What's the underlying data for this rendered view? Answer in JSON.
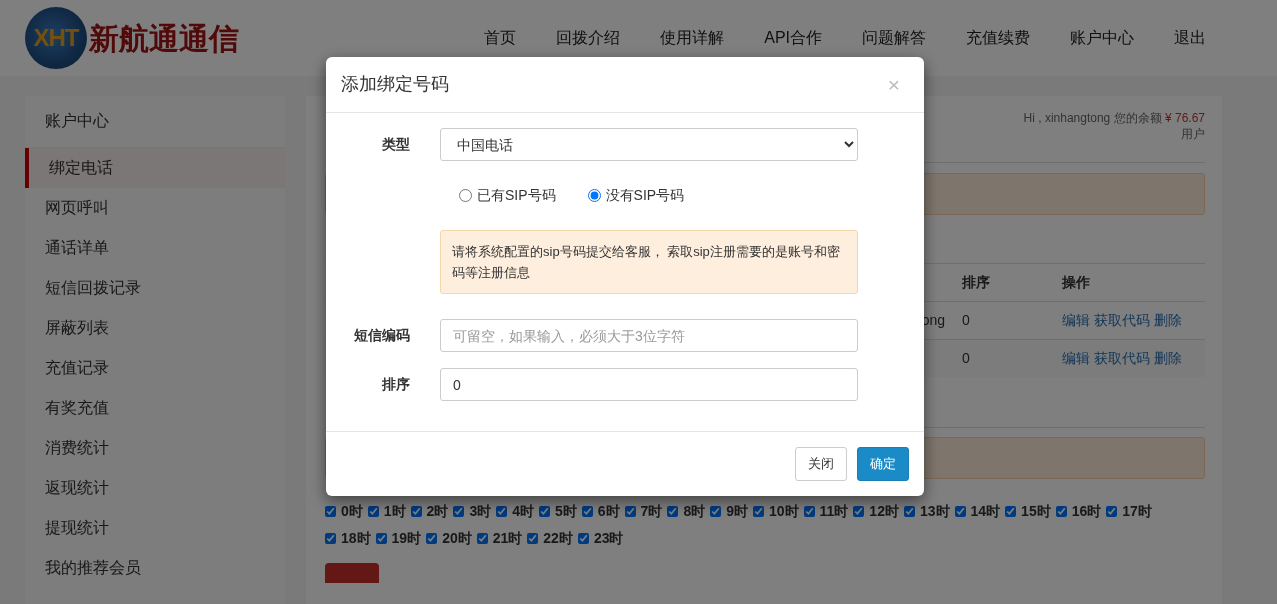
{
  "header": {
    "logo_mark": "XHT",
    "logo_text": "新航通通信",
    "nav": [
      {
        "label": "首页"
      },
      {
        "label": "回拨介绍"
      },
      {
        "label": "使用详解"
      },
      {
        "label": "API合作"
      },
      {
        "label": "问题解答"
      },
      {
        "label": "充值续费"
      },
      {
        "label": "账户中心"
      },
      {
        "label": "退出"
      }
    ]
  },
  "sidebar": {
    "title": "账户中心",
    "items": [
      {
        "label": "绑定电话",
        "selected": true
      },
      {
        "label": "网页呼叫",
        "selected": false
      },
      {
        "label": "通话详单",
        "selected": false
      },
      {
        "label": "短信回拨记录",
        "selected": false
      },
      {
        "label": "屏蔽列表",
        "selected": false
      },
      {
        "label": "充值记录",
        "selected": false
      },
      {
        "label": "有奖充值",
        "selected": false
      },
      {
        "label": "消费统计",
        "selected": false
      },
      {
        "label": "返现统计",
        "selected": false
      },
      {
        "label": "提现统计",
        "selected": false
      },
      {
        "label": "我的推荐会员",
        "selected": false
      }
    ]
  },
  "main": {
    "greeting": "Hi , xinhangtong 您的余额",
    "balance": "¥ 76.67",
    "user_type": "用户",
    "table": {
      "columns": [
        "排序",
        "操作"
      ],
      "rows": [
        {
          "column_1": "ong",
          "sort": "0",
          "actions": [
            "编辑",
            "获取代码",
            "删除"
          ]
        },
        {
          "sort": "0",
          "actions": [
            "编辑",
            "获取代码",
            "删除"
          ]
        }
      ]
    },
    "hours": [
      {
        "label": "0时",
        "checked": true
      },
      {
        "label": "1时",
        "checked": true
      },
      {
        "label": "2时",
        "checked": true
      },
      {
        "label": "3时",
        "checked": true
      },
      {
        "label": "4时",
        "checked": true
      },
      {
        "label": "5时",
        "checked": true
      },
      {
        "label": "6时",
        "checked": true
      },
      {
        "label": "7时",
        "checked": true
      },
      {
        "label": "8时",
        "checked": true
      },
      {
        "label": "9时",
        "checked": true
      },
      {
        "label": "10时",
        "checked": true
      },
      {
        "label": "11时",
        "checked": true
      },
      {
        "label": "12时",
        "checked": true
      },
      {
        "label": "13时",
        "checked": true
      },
      {
        "label": "14时",
        "checked": true
      },
      {
        "label": "15时",
        "checked": true
      },
      {
        "label": "16时",
        "checked": true
      },
      {
        "label": "17时",
        "checked": true
      },
      {
        "label": "18时",
        "checked": true
      },
      {
        "label": "19时",
        "checked": true
      },
      {
        "label": "20时",
        "checked": true
      },
      {
        "label": "21时",
        "checked": true
      },
      {
        "label": "22时",
        "checked": true
      },
      {
        "label": "23时",
        "checked": true
      }
    ]
  },
  "dialog": {
    "title": "添加绑定号码",
    "close": "×",
    "type_label": "类型",
    "type_value": "中国电话",
    "radios": [
      {
        "label": "已有SIP号码",
        "selected": false
      },
      {
        "label": "没有SIP号码",
        "selected": true
      }
    ],
    "notice": "请将系统配置的sip号码提交给客服， 索取sip注册需要的是账号和密码等注册信息",
    "sms_label": "短信编码",
    "sms_placeholder": "可留空，如果输入，必须大于3位字符",
    "sort_label": "排序",
    "sort_value": "0",
    "buttons": [
      {
        "label": "关闭",
        "kind": "secondary"
      },
      {
        "label": "确定",
        "kind": "primary"
      }
    ]
  }
}
